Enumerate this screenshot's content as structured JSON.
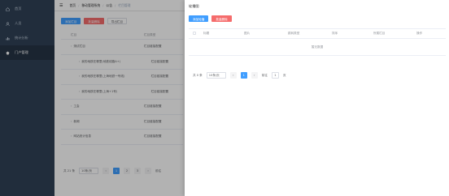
{
  "sidebar": {
    "items": [
      {
        "label": "首页",
        "icon": "home-icon"
      },
      {
        "label": "人员",
        "icon": "user-icon"
      },
      {
        "label": "统计分析",
        "icon": "chart-icon"
      },
      {
        "label": "门户管理",
        "icon": "portal-icon",
        "active": true
      }
    ]
  },
  "header": {
    "breadcrumb": [
      "首页",
      "移动管理系统",
      "公告",
      "栏目管理"
    ]
  },
  "toolbar": {
    "add_label": "添加栏目",
    "delete_label": "批量删除",
    "import_label": "导出栏目"
  },
  "bg_table": {
    "headers": [
      "栏目",
      "栏目类型"
    ],
    "rows": [
      {
        "name": "测试栏目",
        "type": "栏目链接配置"
      },
      {
        "name": "我的地铁在哪里(地铁线路A+)",
        "type": "栏目链接配置"
      },
      {
        "name": "我的地铁在哪里(上海地铁一号线)",
        "type": "栏目链接配置"
      },
      {
        "name": "我的地铁在哪里(上海+1号)",
        "type": "栏目链接配置"
      },
      {
        "name": "工会",
        "type": "栏目链接配置"
      },
      {
        "name": "新闻",
        "type": "栏目链接配置"
      },
      {
        "name": "网站统计信息",
        "type": "栏目链接配置"
      }
    ]
  },
  "bg_pagination": {
    "total": "共 21 条",
    "page_size": "10条/页",
    "pages": [
      "1",
      "2",
      "3"
    ],
    "goto": "前往"
  },
  "drawer": {
    "title": "轮播图",
    "close": "×",
    "add_label": "添加轮播",
    "delete_label": "批量删除",
    "headers": [
      "",
      "标题",
      "图片",
      "跳转类型",
      "排序",
      "所属栏目",
      "操作"
    ],
    "empty_text": "暂无数据",
    "pagination": {
      "total": "共 0 条",
      "page_size": "10条/页",
      "current_page": "1",
      "goto_prefix": "前往",
      "goto_value": "1",
      "goto_suffix": "页"
    }
  },
  "colors": {
    "sidebar": "#304156",
    "primary": "#409eff",
    "danger": "#f56c6c"
  }
}
